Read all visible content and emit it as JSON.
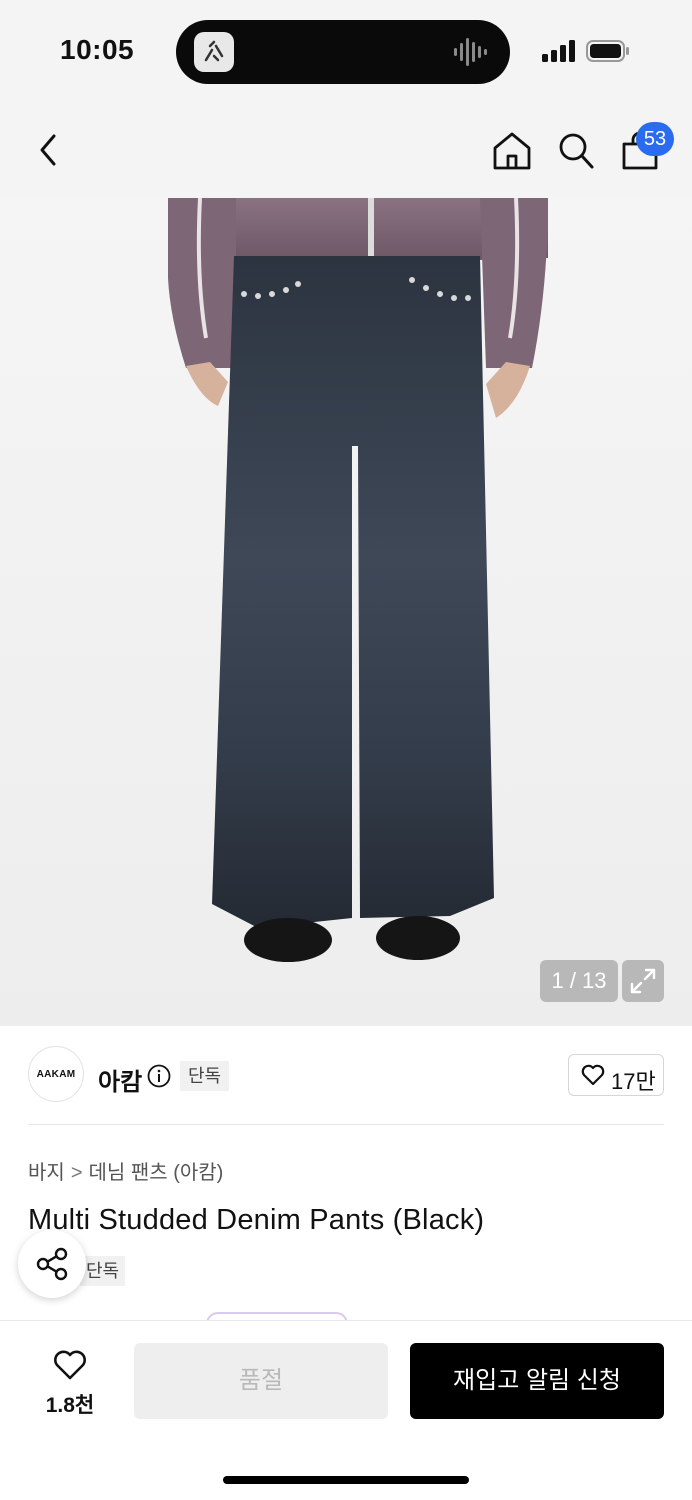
{
  "status_bar": {
    "time": "10:05"
  },
  "nav": {
    "cart_count": "53"
  },
  "gallery": {
    "counter": "1 / 13"
  },
  "brand": {
    "logo_text": "AAKAM",
    "name": "아캄",
    "exclusive_label": "단독",
    "likes": "17만"
  },
  "product": {
    "breadcrumb": [
      "바지",
      "데님 팬츠 (아캄)"
    ],
    "breadcrumb_separator": ">",
    "title": "Multi Studded Denim Pants (Black)",
    "exclusive_label": "단독"
  },
  "bottom_bar": {
    "wish_count": "1.8천",
    "soldout_label": "품절",
    "restock_label": "재입고 알림 신청"
  },
  "colors": {
    "badge_blue": "#2a6bf0",
    "cta_black": "#000000",
    "soldout_gray": "#eeeeee"
  }
}
